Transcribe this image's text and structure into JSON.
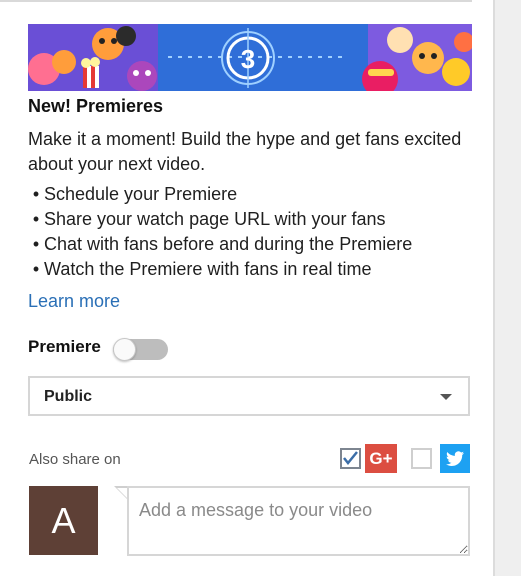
{
  "banner": {
    "countdown_number": "3"
  },
  "premieres": {
    "title": "New! Premieres",
    "description": "Make it a moment! Build the hype and get fans excited about your next video.",
    "bullet_symbol": "•",
    "bullets": [
      "Schedule your Premiere",
      "Share your watch page URL with your fans",
      "Chat with fans before and during the Premiere",
      "Watch the Premiere with fans in real time"
    ],
    "learn_more": "Learn more"
  },
  "premiere_toggle": {
    "label": "Premiere",
    "enabled": false
  },
  "visibility": {
    "selected": "Public"
  },
  "share": {
    "label": "Also share on",
    "google_plus": {
      "checked": true,
      "icon": "google-plus-icon",
      "text": "G+"
    },
    "twitter": {
      "checked": false,
      "icon": "twitter-icon"
    }
  },
  "comment": {
    "avatar_letter": "A",
    "placeholder": "Add a message to your video"
  },
  "colors": {
    "link": "#2a6fb6",
    "google_plus": "#dc4e41",
    "twitter": "#1da1f2",
    "avatar": "#5e4036",
    "banner_bg": "#2f6ed8"
  }
}
